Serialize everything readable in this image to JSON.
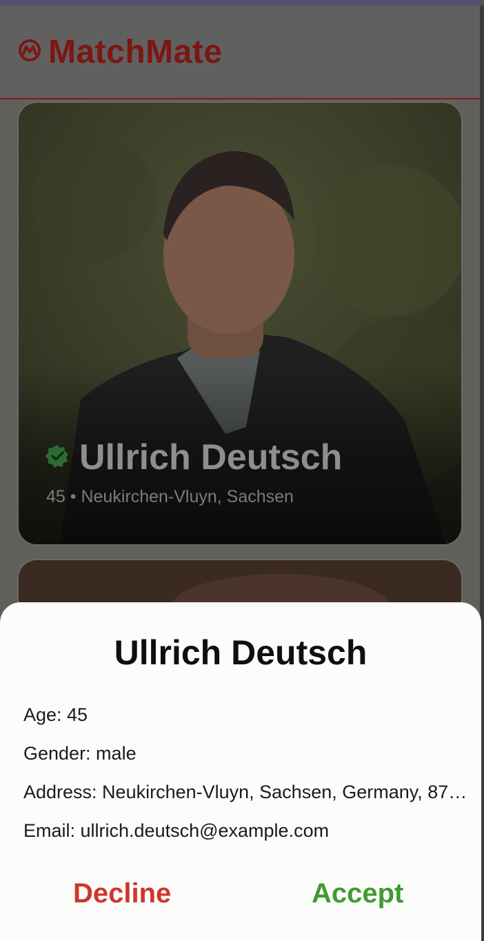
{
  "app": {
    "title": "MatchMate",
    "brand_color": "#7b1714"
  },
  "profile_card": {
    "name": "Ullrich Deutsch",
    "subtitle": "45 • Neukirchen-Vluyn, Sachsen",
    "verified_icon": "verified-badge-icon"
  },
  "details_sheet": {
    "title": "Ullrich Deutsch",
    "age": "Age: 45",
    "gender": "Gender: male",
    "address": "Address: Neukirchen-Vluyn, Sachsen, Germany, 87…",
    "email": "Email: ullrich.deutsch@example.com",
    "decline_label": "Decline",
    "accept_label": "Accept",
    "decline_color": "#d0352b",
    "accept_color": "#3f9a32"
  }
}
